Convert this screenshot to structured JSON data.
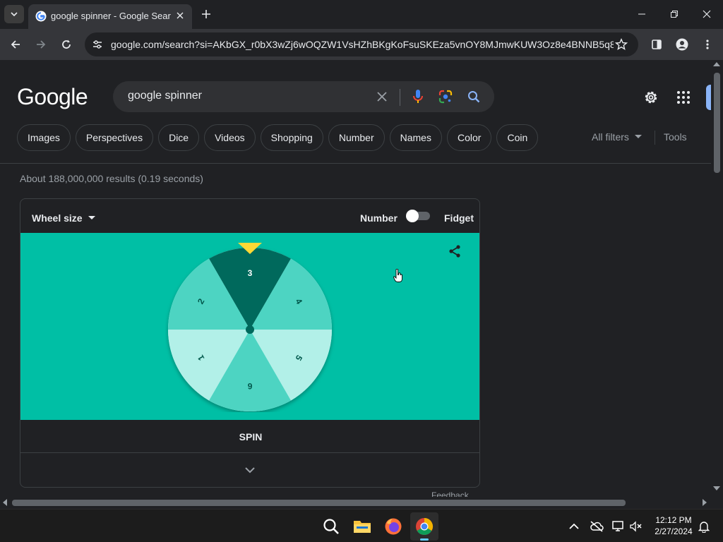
{
  "browser": {
    "tab_title": "google spinner - Google Search",
    "url": "google.com/search?si=AKbGX_r0bX3wZj6wOQZW1VsHZhBKgKoFsuSKEza5vnOY8MJmwKUW3Oz8e4BNNB5q8KB..."
  },
  "search": {
    "logo": "Google",
    "query": "google spinner"
  },
  "chips": [
    "Images",
    "Perspectives",
    "Dice",
    "Videos",
    "Shopping",
    "Number",
    "Names",
    "Color",
    "Coin"
  ],
  "filters": {
    "all_filters": "All filters",
    "tools": "Tools"
  },
  "result_stats": "About 188,000,000 results (0.19 seconds)",
  "spinner": {
    "wheel_size_label": "Wheel size",
    "mode_left": "Number",
    "mode_right": "Fidget",
    "mode_toggle_on": false,
    "segments": [
      "3",
      "4",
      "5",
      "6",
      "1",
      "2"
    ],
    "spin_label": "SPIN",
    "feedback": "Feedback",
    "colors": {
      "background": "#00bfa5",
      "pointer": "#fdd835",
      "highlight": "#00695c"
    }
  },
  "taskbar": {
    "time": "12:12 PM",
    "date": "2/27/2024"
  }
}
